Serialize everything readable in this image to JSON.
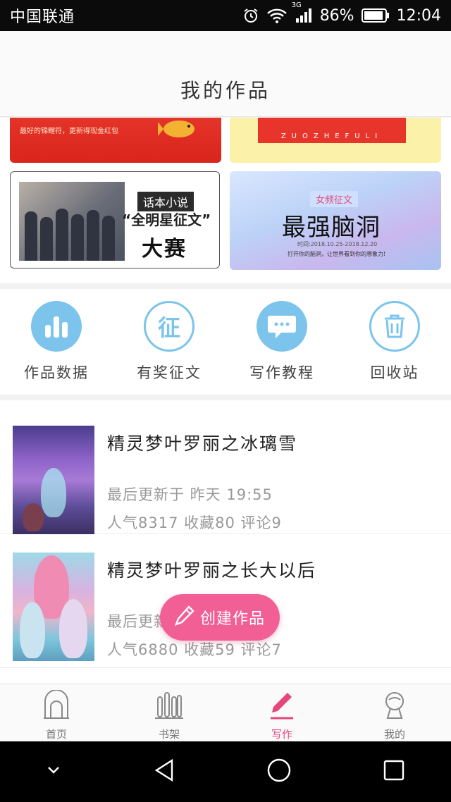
{
  "status_bar": {
    "carrier": "中国联通",
    "network": "3G",
    "battery": "86%",
    "time": "12:04"
  },
  "header": {
    "title": "我的作品"
  },
  "banners": {
    "red_text": "最好的锦鲤符，更新得现金红包",
    "yellow_sub": "ZUOZHEFULI",
    "contest_tag": "话本小说",
    "contest_line1": "“全明星征文”",
    "contest_line2": "大赛",
    "brain_tag": "女频征文",
    "brain_title": "最强脑洞",
    "brain_date": "时间:2018.10.25-2018.12.20",
    "brain_sub": "打开你的脑洞，让世界看到你的想象力!"
  },
  "shortcuts": [
    {
      "label": "作品数据",
      "icon": "bar-chart-icon"
    },
    {
      "label": "有奖征文",
      "icon": "zheng-icon"
    },
    {
      "label": "写作教程",
      "icon": "chat-bubble-icon"
    },
    {
      "label": "回收站",
      "icon": "trash-icon"
    }
  ],
  "works": [
    {
      "title": "精灵梦叶罗丽之冰璃雪",
      "updated": "最后更新于 昨天 19:55",
      "stats": "人气8317 收藏80 评论9"
    },
    {
      "title": "精灵梦叶罗丽之长大以后",
      "updated": "最后更新于",
      "stats": "人气6880 收藏59 评论7"
    }
  ],
  "fab": {
    "label": "创建作品"
  },
  "tabs": [
    {
      "label": "首页",
      "icon": "home-icon",
      "active": false
    },
    {
      "label": "书架",
      "icon": "bookshelf-icon",
      "active": false
    },
    {
      "label": "写作",
      "icon": "pen-icon",
      "active": true
    },
    {
      "label": "我的",
      "icon": "profile-icon",
      "active": false
    }
  ],
  "colors": {
    "accent_pink": "#e6457d",
    "fab_pink": "#f25f95",
    "icon_blue": "#7cc4ec"
  }
}
